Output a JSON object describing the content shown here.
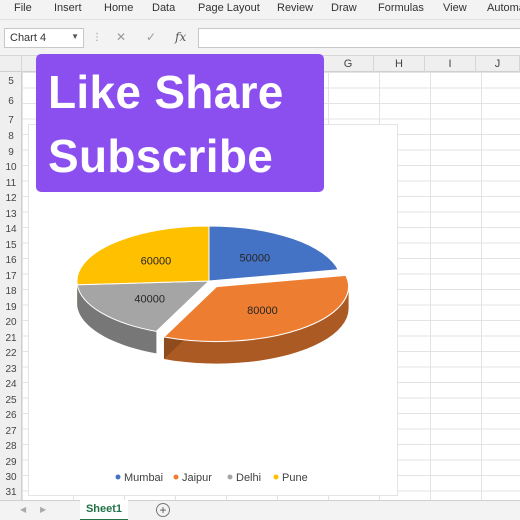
{
  "ribbon": {
    "tabs": [
      "File",
      "Insert",
      "Home",
      "Data",
      "Page Layout",
      "Review",
      "Draw",
      "Formulas",
      "View",
      "Automa"
    ]
  },
  "formula_bar": {
    "name_box": "Chart 4",
    "cancel_icon": "close-icon",
    "enter_icon": "check-icon",
    "fx_label": "fx",
    "formula_value": ""
  },
  "columns": [
    "G",
    "H",
    "I",
    "J"
  ],
  "rows": [
    "5",
    "6",
    "7",
    "8",
    "9",
    "10",
    "11",
    "12",
    "13",
    "14",
    "15",
    "16",
    "17",
    "18",
    "19",
    "20",
    "21",
    "22",
    "23",
    "24",
    "25",
    "26",
    "27",
    "28",
    "29",
    "30",
    "31"
  ],
  "banner": {
    "line1": "Like Share",
    "line2": "Subscribe",
    "background": "#8b4ff0"
  },
  "chart_data": {
    "type": "pie",
    "style": "3d-exploded",
    "categories": [
      "Mumbai",
      "Jaipur",
      "Delhi",
      "Pune"
    ],
    "values": [
      50000,
      80000,
      40000,
      60000
    ],
    "data_labels": [
      "50000",
      "80000",
      "40000",
      "60000"
    ],
    "colors": [
      "#4472c4",
      "#ed7d31",
      "#a5a5a5",
      "#ffc000"
    ],
    "legend_position": "bottom",
    "title": ""
  },
  "sheets": {
    "active": "Sheet1",
    "add_icon": "plus-icon"
  }
}
